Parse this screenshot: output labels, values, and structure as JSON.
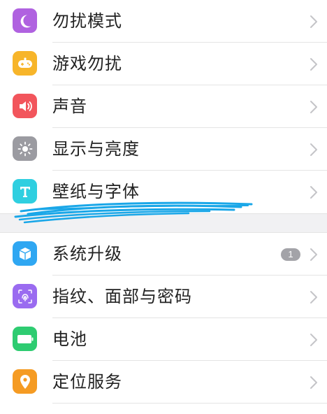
{
  "settings": {
    "group1": [
      {
        "label": "勿扰模式",
        "icon": "moon-icon",
        "color": "#b062e0"
      },
      {
        "label": "游戏勿扰",
        "icon": "gamepad-icon",
        "color": "#f7b52a"
      },
      {
        "label": "声音",
        "icon": "speaker-icon",
        "color": "#f2555c"
      },
      {
        "label": "显示与亮度",
        "icon": "brightness-icon",
        "color": "#9b9ba1"
      },
      {
        "label": "壁纸与字体",
        "icon": "font-icon",
        "color": "#2fcfe0"
      }
    ],
    "group2": [
      {
        "label": "系统升级",
        "icon": "update-box-icon",
        "color": "#2fa7f2",
        "badge": "1"
      },
      {
        "label": "指纹、面部与密码",
        "icon": "fingerprint-icon",
        "color": "#9a6bf0"
      },
      {
        "label": "电池",
        "icon": "battery-icon",
        "color": "#2ecc71"
      },
      {
        "label": "定位服务",
        "icon": "location-pin-icon",
        "color": "#f59b23"
      }
    ]
  },
  "annotation": {
    "scribble_color": "#1aa7e8"
  }
}
